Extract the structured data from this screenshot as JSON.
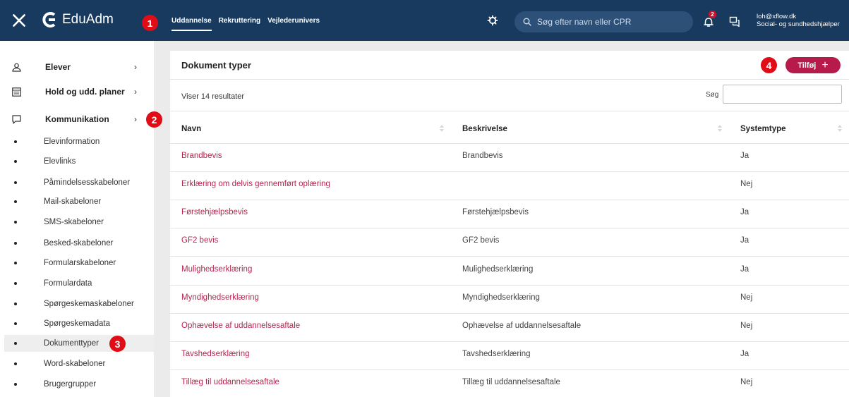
{
  "header": {
    "app_name": "EduAdm",
    "tabs": [
      "Uddannelse",
      "Rekruttering",
      "Vejlederunivers"
    ],
    "search_placeholder": "Søg efter navn eller CPR",
    "notification_count": "2",
    "user_email": "loh@xflow.dk",
    "user_role": "Social- og sundhedshjælper"
  },
  "callouts": [
    "1",
    "2",
    "3",
    "4"
  ],
  "sidebar": {
    "main_items": [
      {
        "label": "Elever",
        "icon": "person-icon"
      },
      {
        "label": "Hold og udd. planer",
        "icon": "calendar-icon"
      },
      {
        "label": "Kommunikation",
        "icon": "chat-icon"
      }
    ],
    "sub_items": [
      "Elevinformation",
      "Elevlinks",
      "Påmindelsesskabeloner",
      "Mail-skabeloner",
      "SMS-skabeloner",
      "Besked-skabeloner",
      "Formularskabeloner",
      "Formulardata",
      "Spørgeskemaskabeloner",
      "Spørgeskemadata",
      "Dokumenttyper",
      "Word-skabeloner",
      "Brugergrupper"
    ],
    "active_sub_item": "Dokumenttyper"
  },
  "main": {
    "title": "Dokument typer",
    "add_button_label": "Tilføj",
    "results_text": "Viser 14 resultater",
    "search_label": "Søg",
    "columns": [
      "Navn",
      "Beskrivelse",
      "Systemtype"
    ],
    "rows": [
      [
        "Brandbevis",
        "Brandbevis",
        "Ja"
      ],
      [
        "Erklæring om delvis gennemført oplæring",
        "",
        "Nej"
      ],
      [
        "Førstehjælpsbevis",
        "Førstehjælpsbevis",
        "Ja"
      ],
      [
        "GF2 bevis",
        "GF2 bevis",
        "Ja"
      ],
      [
        "Mulighedserklæring",
        "Mulighedserklæring",
        "Ja"
      ],
      [
        "Myndighedserklæring",
        "Myndighedserklæring",
        "Nej"
      ],
      [
        "Ophævelse af uddannelsesaftale",
        "Ophævelse af uddannelsesaftale",
        "Nej"
      ],
      [
        "Tavshedserklæring",
        "Tavshedserklæring",
        "Ja"
      ],
      [
        "Tillæg til uddannelsesaftale",
        "Tillæg til uddannelsesaftale",
        "Nej"
      ]
    ]
  },
  "colors": {
    "topbar": "#173a5e",
    "accent": "#b71b4b",
    "link": "#b5264f",
    "callout": "#e00c16"
  }
}
